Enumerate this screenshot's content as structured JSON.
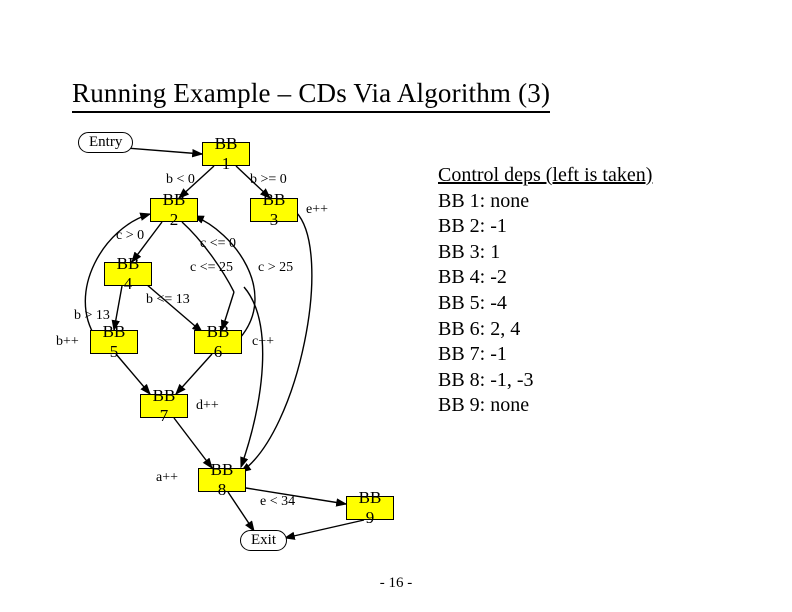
{
  "title": "Running Example – CDs Via Algorithm (3)",
  "nodes": {
    "entry": "Entry",
    "exit": "Exit",
    "bb1": "BB 1",
    "bb2": "BB 2",
    "bb3": "BB 3",
    "bb4": "BB 4",
    "bb5": "BB 5",
    "bb6": "BB 6",
    "bb7": "BB 7",
    "bb8": "BB 8",
    "bb9": "BB 9"
  },
  "edge_labels": {
    "b_lt_0": "b < 0",
    "b_ge_0": "b >= 0",
    "e_pp": "e++",
    "c_gt_0": "c > 0",
    "c_le_0": "c <= 0",
    "c_le_25": "c <= 25",
    "c_gt_25": "c > 25",
    "b_le_13": "b <= 13",
    "b_gt_13": "b > 13",
    "b_pp": "b++",
    "c_pp": "c++",
    "d_pp": "d++",
    "a_pp": "a++",
    "e_lt_34": "e < 34"
  },
  "sidetext": {
    "heading": "Control deps (left is taken)",
    "lines": [
      "BB 1: none",
      "BB 2: -1",
      "BB 3: 1",
      "BB 4: -2",
      "BB 5: -4",
      "BB 6: 2, 4",
      "BB 7: -1",
      "BB 8: -1, -3",
      "BB 9: none"
    ]
  },
  "pagenum": "- 16 -"
}
